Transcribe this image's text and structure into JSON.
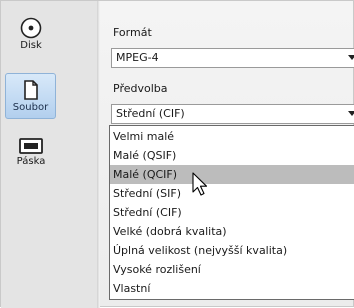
{
  "tabs": [
    {
      "label": "Disk",
      "icon": "disk-icon",
      "active": false
    },
    {
      "label": "Soubor",
      "icon": "file-icon",
      "active": true
    },
    {
      "label": "Páska",
      "icon": "tape-icon",
      "active": false
    }
  ],
  "format": {
    "label": "Formát",
    "value": "MPEG-4"
  },
  "preset": {
    "label": "Předvolba",
    "value": "Střední (CIF)",
    "options": [
      "Velmi malé",
      "Malé (QSIF)",
      "Malé (QCIF)",
      "Střední (SIF)",
      "Střední (CIF)",
      "Velké (dobrá kvalita)",
      "Úplná velikost (nejvyšší kvalita)",
      "Vysoké rozlišení",
      "Vlastní"
    ],
    "highlighted_index": 2
  },
  "colors": {
    "active_tab": "#bcd5f0",
    "highlight": "#bcbcbc",
    "panel": "#ececec"
  }
}
